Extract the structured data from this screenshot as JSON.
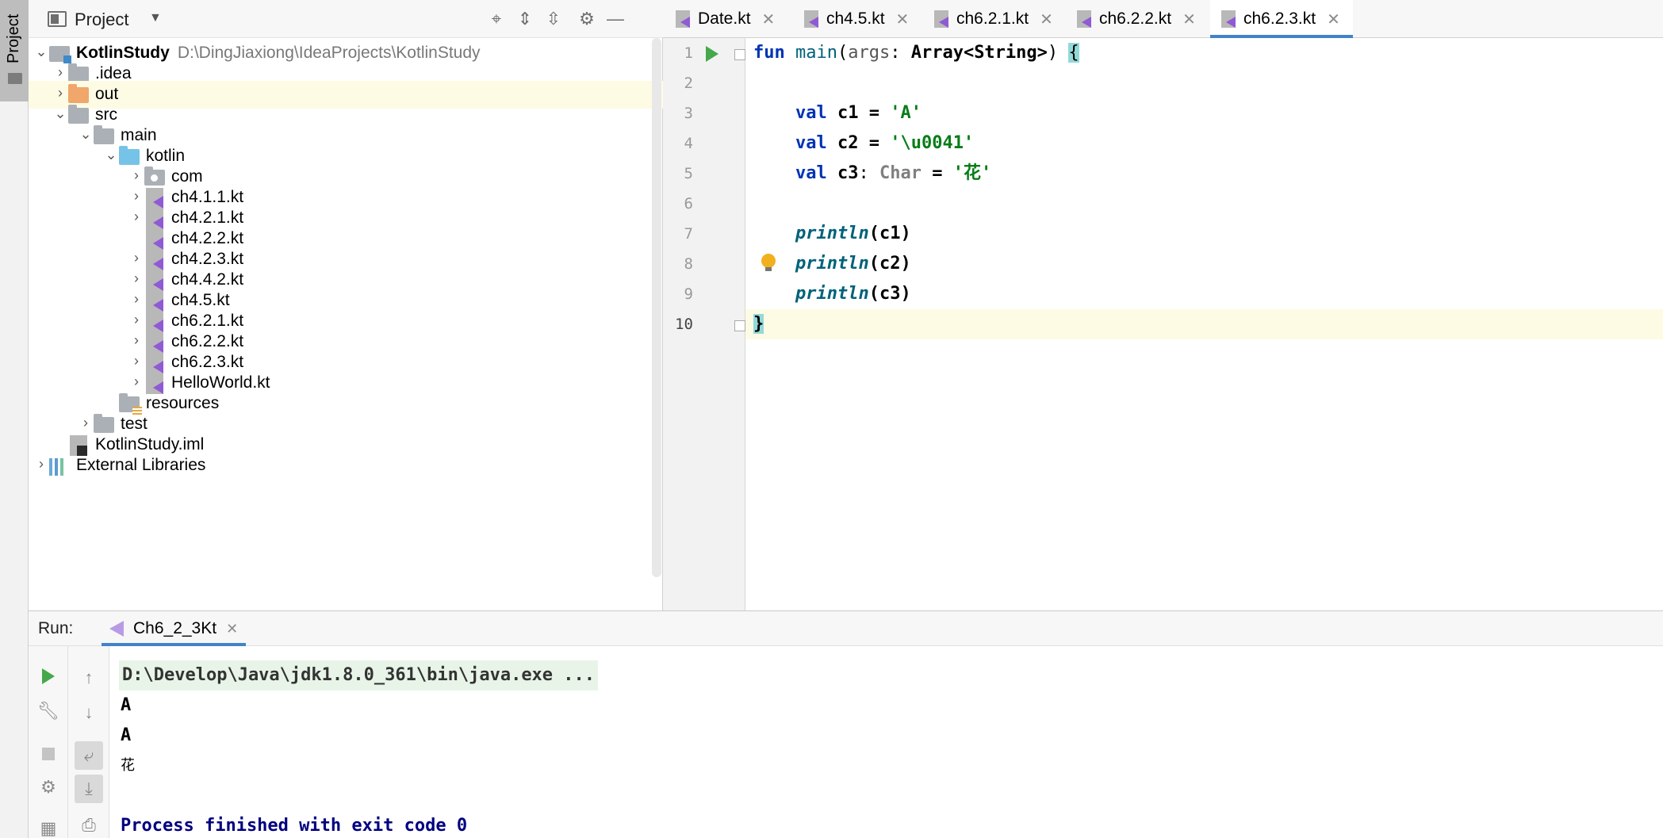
{
  "stripe": {
    "label": "Project"
  },
  "project": {
    "title": "Project",
    "tree": [
      {
        "label": "KotlinStudy",
        "path": "D:\\DingJiaxiong\\IdeaProjects\\KotlinStudy"
      },
      {
        "label": ".idea"
      },
      {
        "label": "out"
      },
      {
        "label": "src"
      },
      {
        "label": "main"
      },
      {
        "label": "kotlin"
      },
      {
        "label": "com"
      },
      {
        "label": "ch4.1.1.kt"
      },
      {
        "label": "ch4.2.1.kt"
      },
      {
        "label": "ch4.2.2.kt"
      },
      {
        "label": "ch4.2.3.kt"
      },
      {
        "label": "ch4.4.2.kt"
      },
      {
        "label": "ch4.5.kt"
      },
      {
        "label": "ch6.2.1.kt"
      },
      {
        "label": "ch6.2.2.kt"
      },
      {
        "label": "ch6.2.3.kt"
      },
      {
        "label": "HelloWorld.kt"
      },
      {
        "label": "resources"
      },
      {
        "label": "test"
      },
      {
        "label": "KotlinStudy.iml"
      },
      {
        "label": "External Libraries"
      }
    ]
  },
  "editor": {
    "tabs": [
      {
        "label": "Date.kt",
        "active": false
      },
      {
        "label": "ch4.5.kt",
        "active": false
      },
      {
        "label": "ch6.2.1.kt",
        "active": false
      },
      {
        "label": "ch6.2.2.kt",
        "active": false
      },
      {
        "label": "ch6.2.3.kt",
        "active": true
      }
    ],
    "line_numbers": [
      "1",
      "2",
      "3",
      "4",
      "5",
      "6",
      "7",
      "8",
      "9",
      "10"
    ],
    "code": {
      "l1": {
        "kw": "fun",
        "fn": "main",
        "open": "(",
        "param": "args",
        "colon": ": ",
        "type": "Array<String>",
        "close": ") ",
        "brace": "{"
      },
      "l3": {
        "kw": "val",
        "name": " c1 = ",
        "str": "'A'"
      },
      "l4": {
        "kw": "val",
        "name": " c2 = ",
        "str": "'\\u0041'"
      },
      "l5": {
        "kw": "val",
        "name": " c3",
        "colon": ": ",
        "type": "Char",
        "eq": " = ",
        "str": "'花'"
      },
      "l7": {
        "call": "println",
        "args": "(c1)"
      },
      "l8": {
        "call": "println",
        "args": "(c2)"
      },
      "l9": {
        "call": "println",
        "args": "(c3)"
      },
      "l10": {
        "brace": "}"
      }
    }
  },
  "run": {
    "label": "Run:",
    "tab": "Ch6_2_3Kt",
    "console": {
      "command": "D:\\Develop\\Java\\jdk1.8.0_361\\bin\\java.exe ...",
      "out1": "A",
      "out2": "A",
      "out3": "花",
      "finished": "Process finished with exit code 0"
    }
  }
}
